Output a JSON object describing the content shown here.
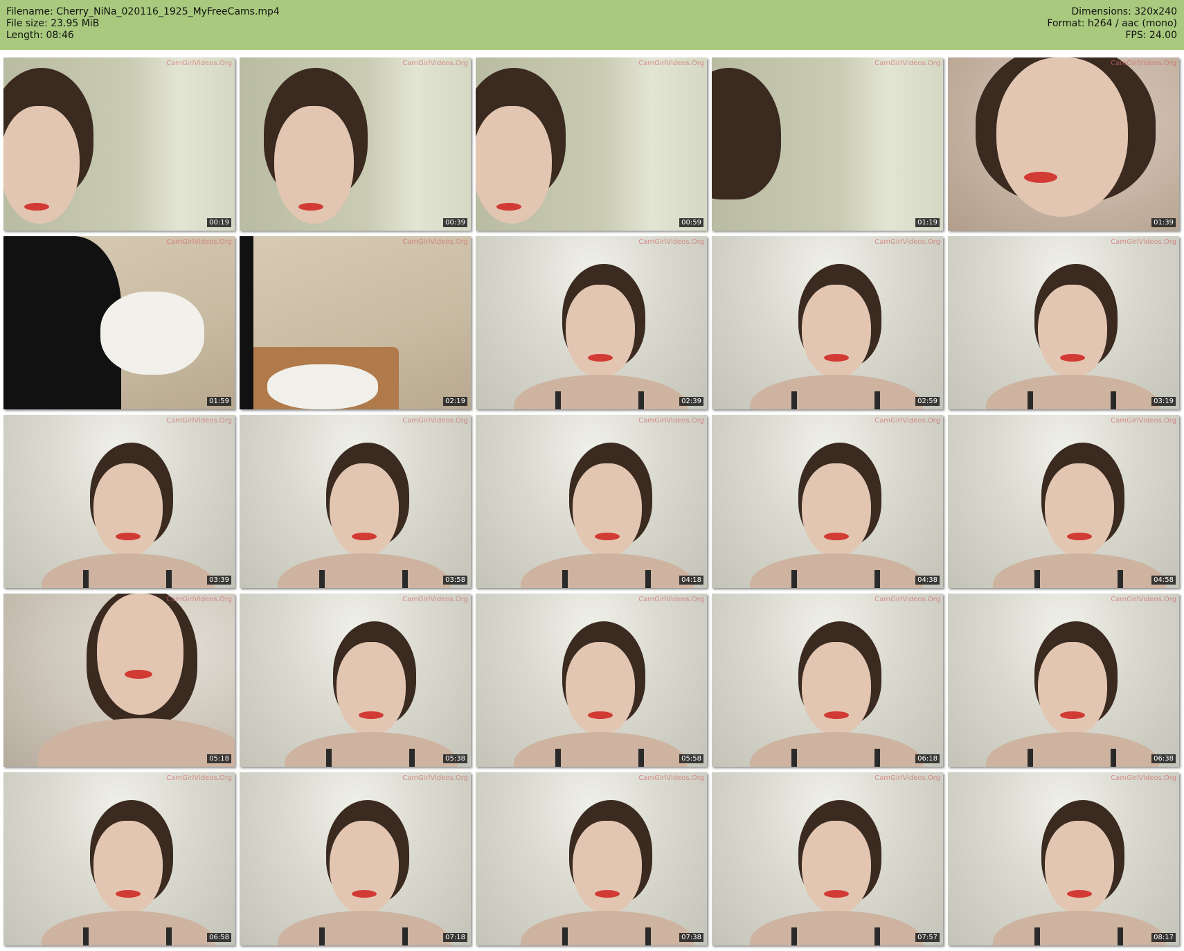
{
  "header": {
    "filename": "Filename: Cherry_NiNa_020116_1925_MyFreeCams.mp4",
    "filesize": "File size: 23.95 MiB",
    "length": "Length: 08:46",
    "dimensions": "Dimensions: 320x240",
    "format": "Format: h264 / aac (mono)",
    "fps": "FPS: 24.00"
  },
  "watermark": "CamGirlVideos.Org",
  "thumbnails": [
    {
      "time": "00:19",
      "scene": "wall"
    },
    {
      "time": "00:39",
      "scene": "wall"
    },
    {
      "time": "00:59",
      "scene": "wall"
    },
    {
      "time": "01:19",
      "scene": "wall"
    },
    {
      "time": "01:39",
      "scene": "close"
    },
    {
      "time": "01:59",
      "scene": "room"
    },
    {
      "time": "02:19",
      "scene": "room"
    },
    {
      "time": "02:39",
      "scene": "grey"
    },
    {
      "time": "02:59",
      "scene": "grey"
    },
    {
      "time": "03:19",
      "scene": "grey"
    },
    {
      "time": "03:39",
      "scene": "grey"
    },
    {
      "time": "03:58",
      "scene": "grey"
    },
    {
      "time": "04:18",
      "scene": "grey"
    },
    {
      "time": "04:38",
      "scene": "grey"
    },
    {
      "time": "04:58",
      "scene": "grey"
    },
    {
      "time": "05:18",
      "scene": "lip"
    },
    {
      "time": "05:38",
      "scene": "grey"
    },
    {
      "time": "05:58",
      "scene": "grey"
    },
    {
      "time": "06:18",
      "scene": "grey"
    },
    {
      "time": "06:38",
      "scene": "grey"
    },
    {
      "time": "06:58",
      "scene": "grey"
    },
    {
      "time": "07:18",
      "scene": "grey"
    },
    {
      "time": "07:38",
      "scene": "grey"
    },
    {
      "time": "07:57",
      "scene": "grey"
    },
    {
      "time": "08:17",
      "scene": "grey"
    }
  ]
}
